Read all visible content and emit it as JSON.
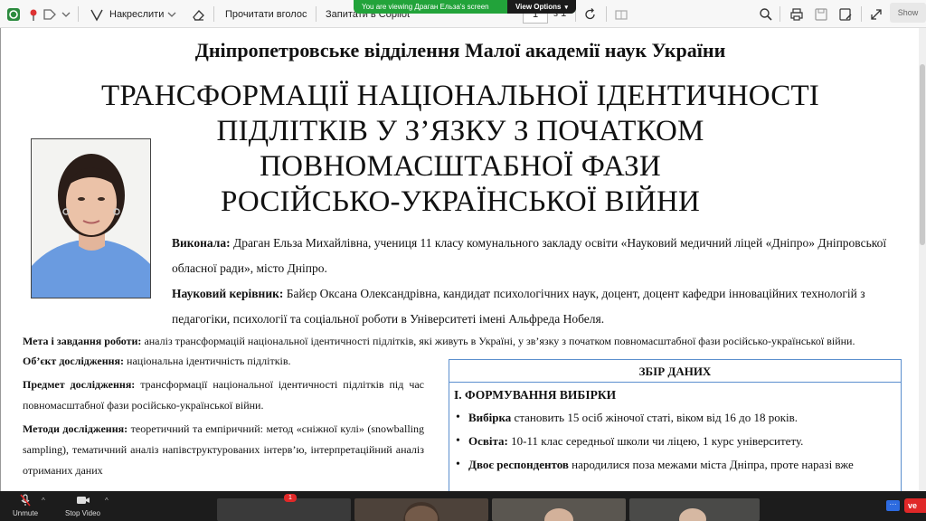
{
  "toolbar": {
    "draw_label": "Накреслити",
    "read_aloud_label": "Прочитати вголос",
    "copilot_label": "Запитати в Copilot",
    "page_current": "1",
    "page_total": "з 1",
    "sidebar_tab": "Show"
  },
  "share_banner": {
    "text": "You are viewing Драган Ельза's screen",
    "view_options": "View Options"
  },
  "document": {
    "org": "Дніпропетровське відділення Малої академії наук України",
    "title_lines": [
      "ТРАНСФОРМАЦІЇ НАЦІОНАЛЬНОЇ ІДЕНТИЧНОСТІ",
      "ПІДЛІТКІВ У З’ЯЗКУ З ПОЧАТКОМ",
      "ПОВНОМАСШТАБНОЇ ФАЗИ",
      "РОСІЙСЬКО-УКРАЇНСЬКОЇ ВІЙНИ"
    ],
    "author_label": "Виконала:",
    "author_text": " Драган Ельза Михайлівна, учениця 11 класу комунального закладу освіти «Науковий медичний ліцей «Дніпро» Дніпровської обласної ради», місто Дніпро.",
    "supervisor_label": "Науковий керівник:",
    "supervisor_text": " Байєр Оксана Олександрівна, кандидат психологічних наук, доцент, доцент кафедри інноваційних технологій з педагогіки, психології та соціальної роботи в Університеті імені Альфреда Нобеля.",
    "goal_label": "Мета і завдання роботи:",
    "goal_text": " аналіз трансформацій національної ідентичності підлітків, які живуть в Україні, у зв’язку з початком повномасштабної фази російсько-української війни.",
    "object_label": "Об’єкт дослідження:",
    "object_text": " національна ідентичність підлітків.",
    "subject_label": "Предмет дослідження:",
    "subject_text": " трансформації національної ідентичності підлітків під час повномасштабної фази російсько-української війни.",
    "methods_label": "Методи дослідження:",
    "methods_text": " теоретичний та емпіричний: метод «сніжної кулі» (snowballing sampling), тематичний аналіз напівструктурованих інтерв’ю, інтерпретаційний аналіз отриманих даних",
    "collect": {
      "heading": "ЗБІР ДАНИХ",
      "subheading": "I. ФОРМУВАННЯ ВИБІРКИ",
      "items": [
        {
          "label": "Вибірка",
          "text": " становить 15 осіб жіночої статі, віком від 16 до 18 років."
        },
        {
          "label": "Освіта:",
          "text": " 10-11 клас середньої школи чи ліцею, 1 курс університету."
        },
        {
          "label": "Двоє респондентов",
          "text": " народилися поза межами міста Дніпра, проте наразі вже"
        }
      ]
    }
  },
  "zoombar": {
    "unmute": "Unmute",
    "stop_video": "Stop Video",
    "chat_badge": "1",
    "more": "···",
    "leave": "ve"
  },
  "colors": {
    "banner_green": "#22a33a",
    "box_border": "#5b8fce",
    "leave_red": "#e02828",
    "shirt_blue": "#6a9be0"
  }
}
